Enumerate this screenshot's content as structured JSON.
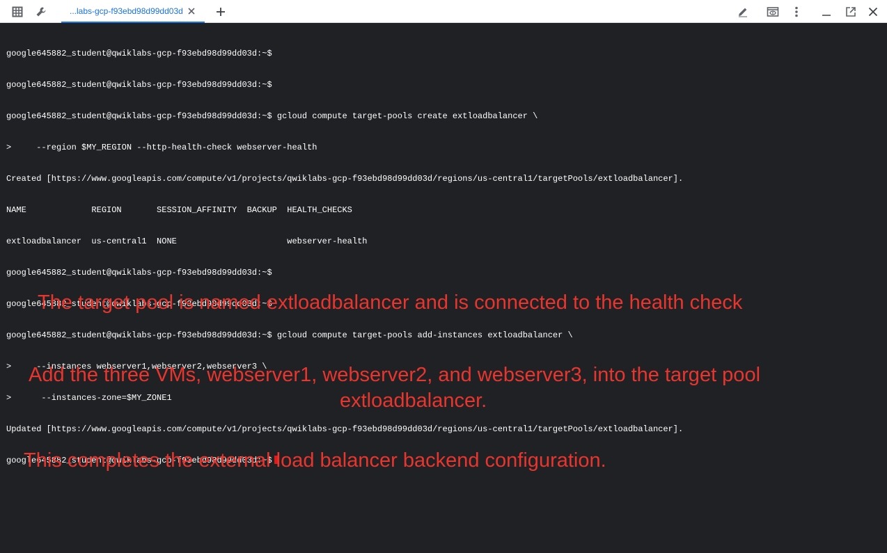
{
  "toolbar": {
    "left_icons": [
      "grid-icon",
      "wrench-icon"
    ],
    "tab": {
      "label": "...labs-gcp-f93ebd98d99dd03d"
    },
    "new_tab_icon": "plus-icon",
    "right_icons": [
      "pencil-icon",
      "preview-icon",
      "more-vert-icon",
      "minimize-icon",
      "popout-icon",
      "close-icon"
    ],
    "accent": "#1a73e8"
  },
  "terminal": {
    "lines": [
      "google645882_student@qwiklabs-gcp-f93ebd98d99dd03d:~$",
      "google645882_student@qwiklabs-gcp-f93ebd98d99dd03d:~$",
      "google645882_student@qwiklabs-gcp-f93ebd98d99dd03d:~$ gcloud compute target-pools create extloadbalancer \\",
      ">     --region $MY_REGION --http-health-check webserver-health",
      "Created [https://www.googleapis.com/compute/v1/projects/qwiklabs-gcp-f93ebd98d99dd03d/regions/us-central1/targetPools/extloadbalancer].",
      "NAME             REGION       SESSION_AFFINITY  BACKUP  HEALTH_CHECKS",
      "extloadbalancer  us-central1  NONE                      webserver-health",
      "google645882_student@qwiklabs-gcp-f93ebd98d99dd03d:~$",
      "google645882_student@qwiklabs-gcp-f93ebd98d99dd03d:~$",
      "google645882_student@qwiklabs-gcp-f93ebd98d99dd03d:~$ gcloud compute target-pools add-instances extloadbalancer \\",
      ">     --instances webserver1,webserver2,webserver3 \\",
      ">      --instances-zone=$MY_ZONE1",
      "Updated [https://www.googleapis.com/compute/v1/projects/qwiklabs-gcp-f93ebd98d99dd03d/regions/us-central1/targetPools/extloadbalancer]."
    ],
    "prompt": "google645882_student@qwiklabs-gcp-f93ebd98d99dd03d:~$",
    "background": "#202124",
    "cursor_color": "#e01b1b"
  },
  "annotations": {
    "line1": "The target pool is named extloadbalancer and is connected to the health check",
    "line2a": "Add the three VMs, webserver1, webserver2, and webserver3, into the target pool",
    "line2b": "extloadbalancer.",
    "line3": "This completes the external load balancer backend configuration.",
    "color": "#e8352e"
  }
}
